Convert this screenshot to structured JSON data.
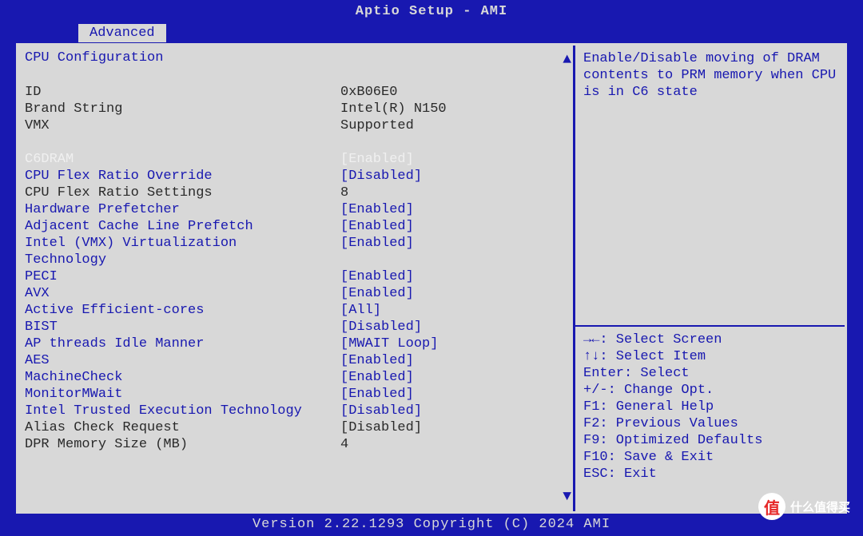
{
  "title": "Aptio Setup - AMI",
  "tab": "Advanced",
  "section_title": "CPU Configuration",
  "info_rows": [
    {
      "label": "ID",
      "value": "0xB06E0"
    },
    {
      "label": "Brand String",
      "value": "Intel(R) N150"
    },
    {
      "label": "VMX",
      "value": "Supported"
    }
  ],
  "selected": {
    "label": "C6DRAM",
    "value": "[Enabled]"
  },
  "options": [
    {
      "label": "CPU Flex Ratio Override",
      "value": "[Disabled]",
      "type": "opt"
    },
    {
      "label": "CPU Flex Ratio Settings",
      "value": "8",
      "type": "ro"
    },
    {
      "label": "Hardware Prefetcher",
      "value": "[Enabled]",
      "type": "opt"
    },
    {
      "label": "Adjacent Cache Line Prefetch",
      "value": "[Enabled]",
      "type": "opt"
    },
    {
      "label": "Intel (VMX) Virtualization",
      "value": "[Enabled]",
      "type": "opt"
    },
    {
      "label": "Technology",
      "value": "",
      "type": "opt"
    },
    {
      "label": "PECI",
      "value": "[Enabled]",
      "type": "opt"
    },
    {
      "label": "AVX",
      "value": "[Enabled]",
      "type": "opt"
    },
    {
      "label": "Active Efficient-cores",
      "value": "[All]",
      "type": "opt"
    },
    {
      "label": "BIST",
      "value": "[Disabled]",
      "type": "opt"
    },
    {
      "label": "AP threads Idle Manner",
      "value": "[MWAIT Loop]",
      "type": "opt"
    },
    {
      "label": "AES",
      "value": "[Enabled]",
      "type": "opt"
    },
    {
      "label": "MachineCheck",
      "value": "[Enabled]",
      "type": "opt"
    },
    {
      "label": "MonitorMWait",
      "value": "[Enabled]",
      "type": "opt"
    },
    {
      "label": "Intel Trusted Execution Technology",
      "value": "[Disabled]",
      "type": "opt"
    },
    {
      "label": "Alias Check Request",
      "value": "[Disabled]",
      "type": "ro"
    },
    {
      "label": "DPR Memory Size (MB)",
      "value": "4",
      "type": "ro"
    }
  ],
  "help_text": "Enable/Disable moving of DRAM contents to PRM memory when CPU is in C6 state",
  "help_keys": [
    "→←: Select Screen",
    "↑↓: Select Item",
    "Enter: Select",
    "+/-: Change Opt.",
    "F1: General Help",
    "F2: Previous Values",
    "F9: Optimized Defaults",
    "F10: Save & Exit",
    "ESC: Exit"
  ],
  "footer": "Version 2.22.1293 Copyright (C) 2024 AMI",
  "watermark": {
    "icon": "值",
    "text": "什么值得买"
  }
}
